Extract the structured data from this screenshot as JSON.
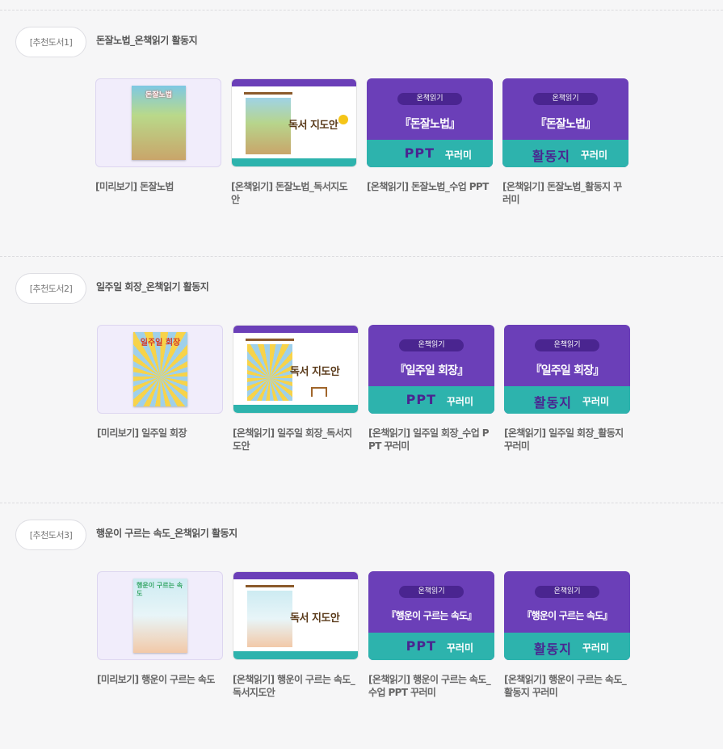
{
  "thumb_texts": {
    "guide": "독서 지도안",
    "pill": "온책읽기",
    "ppt_big": "PPT",
    "activity_big": "활동지",
    "decor": "꾸러미"
  },
  "colors": {
    "purple": "#6b3fb8",
    "teal": "#2db3ad",
    "lavender": "#f1edfb"
  },
  "sections": [
    {
      "badge": "[추천도서1]",
      "title": "돈잘노법_온책읽기 활동지",
      "cover_text": "돈잘노법",
      "ppt_title": "『돈잘노법』",
      "captions": [
        "[미리보기] 돈잘노법",
        "[온책읽기] 돈잘노법_독서지도안",
        "[온책읽기] 돈잘노법_수업 PPT",
        "[온책읽기] 돈잘노법_활동지 꾸러미"
      ]
    },
    {
      "badge": "[추천도서2]",
      "title": "일주일 회장_온책읽기 활동지",
      "cover_text": "일주일 회장",
      "ppt_title": "『일주일 회장』",
      "captions": [
        "[미리보기] 일주일 회장",
        "[온책읽기] 일주일 회장_독서지도안",
        "[온책읽기] 일주일 회장_수업 PPT 꾸러미",
        "[온책읽기] 일주일 회장_활동지 꾸러미"
      ]
    },
    {
      "badge": "[추천도서3]",
      "title": "행운이 구르는 속도_온책읽기 활동지",
      "cover_text": "행운이 구르는 속도",
      "ppt_title": "『행운이 구르는 속도』",
      "captions": [
        "[미리보기] 행운이 구르는 속도",
        "[온책읽기] 행운이 구르는 속도_독서지도안",
        "[온책읽기] 행운이 구르는 속도_수업 PPT 꾸러미",
        "[온책읽기] 행운이 구르는 속도_활동지 꾸러미"
      ]
    }
  ]
}
